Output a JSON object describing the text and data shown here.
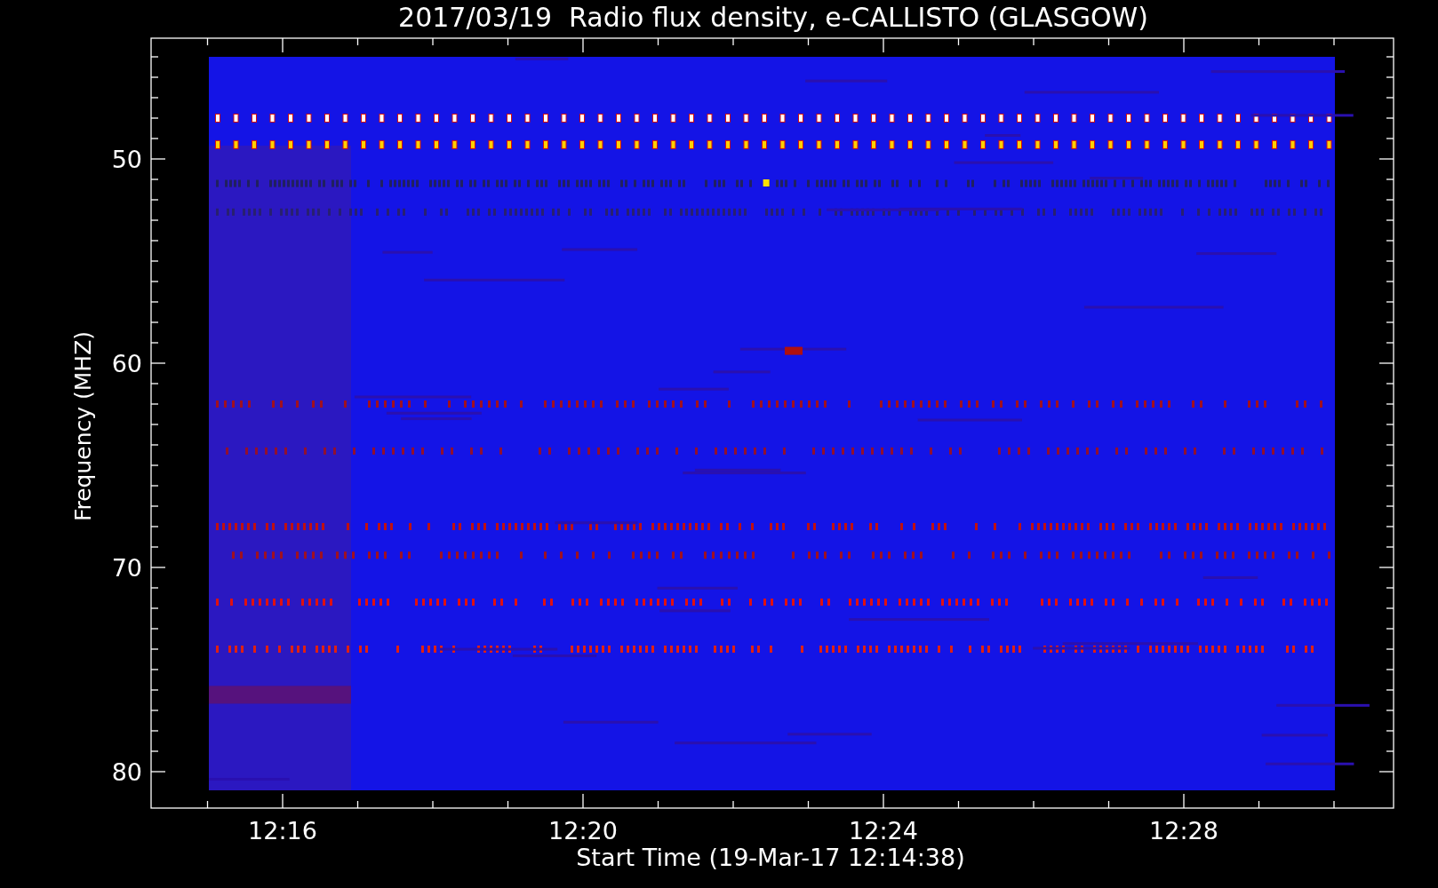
{
  "title": "2017/03/19  Radio flux density, e-CALLISTO (GLASGOW)",
  "y_axis": {
    "label": "Frequency (MHZ)",
    "ticks": [
      "50",
      "60",
      "70",
      "80"
    ]
  },
  "x_axis": {
    "label": "Start Time (19-Mar-17 12:14:38)",
    "ticks": [
      "12:16",
      "12:20",
      "12:24",
      "12:28"
    ]
  }
}
